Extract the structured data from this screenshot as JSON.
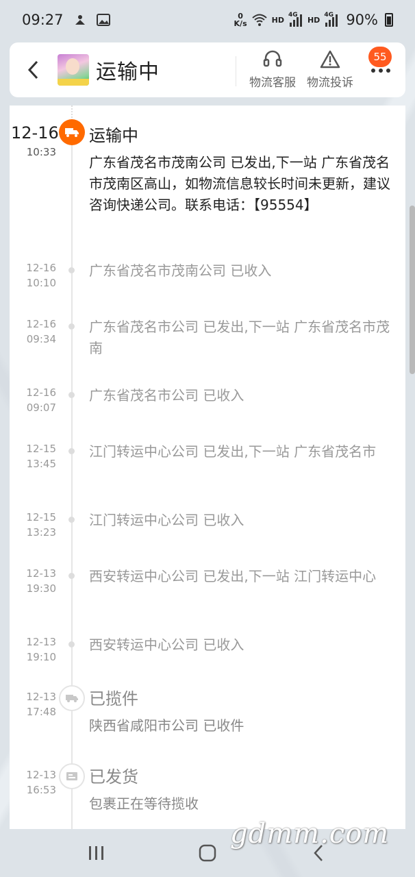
{
  "status_bar": {
    "time": "09:27",
    "net_speed_value": "0",
    "net_speed_unit": "K/s",
    "hd1": "HD",
    "hd2": "HD",
    "net1": "4G",
    "net2": "4G",
    "battery": "90%"
  },
  "header": {
    "title": "运输中",
    "service_label": "物流客服",
    "complaint_label": "物流投诉",
    "badge": "55"
  },
  "current": {
    "date": "12-16",
    "time": "10:33",
    "title": "运输中",
    "text": "广东省茂名市茂南公司 已发出,下一站 广东省茂名市茂南区高山，如物流信息较长时间未更新，建议咨询快递公司。联系电话：【95554】"
  },
  "events": [
    {
      "date": "12-16",
      "time": "10:10",
      "text": "广东省茂名市茂南公司 已收入"
    },
    {
      "date": "12-16",
      "time": "09:34",
      "text": "广东省茂名市公司 已发出,下一站 广东省茂名市茂南"
    },
    {
      "date": "12-16",
      "time": "09:07",
      "text": "广东省茂名市公司 已收入"
    },
    {
      "date": "12-15",
      "time": "13:45",
      "text": "江门转运中心公司 已发出,下一站 广东省茂名市"
    },
    {
      "date": "12-15",
      "time": "13:23",
      "text": "江门转运中心公司 已收入"
    },
    {
      "date": "12-13",
      "time": "19:30",
      "text": "西安转运中心公司 已发出,下一站 江门转运中心"
    },
    {
      "date": "12-13",
      "time": "19:10",
      "text": "西安转运中心公司 已收入"
    }
  ],
  "pickup": {
    "date": "12-13",
    "time": "17:48",
    "title": "已揽件",
    "text": "陕西省咸阳市公司 已收件"
  },
  "shipped": {
    "date": "12-13",
    "time": "16:53",
    "title": "已发货",
    "text": "包裹正在等待揽收"
  },
  "watermark": "gdmm.com",
  "colors": {
    "accent": "#ff6a00",
    "badge": "#ff5a1f"
  }
}
